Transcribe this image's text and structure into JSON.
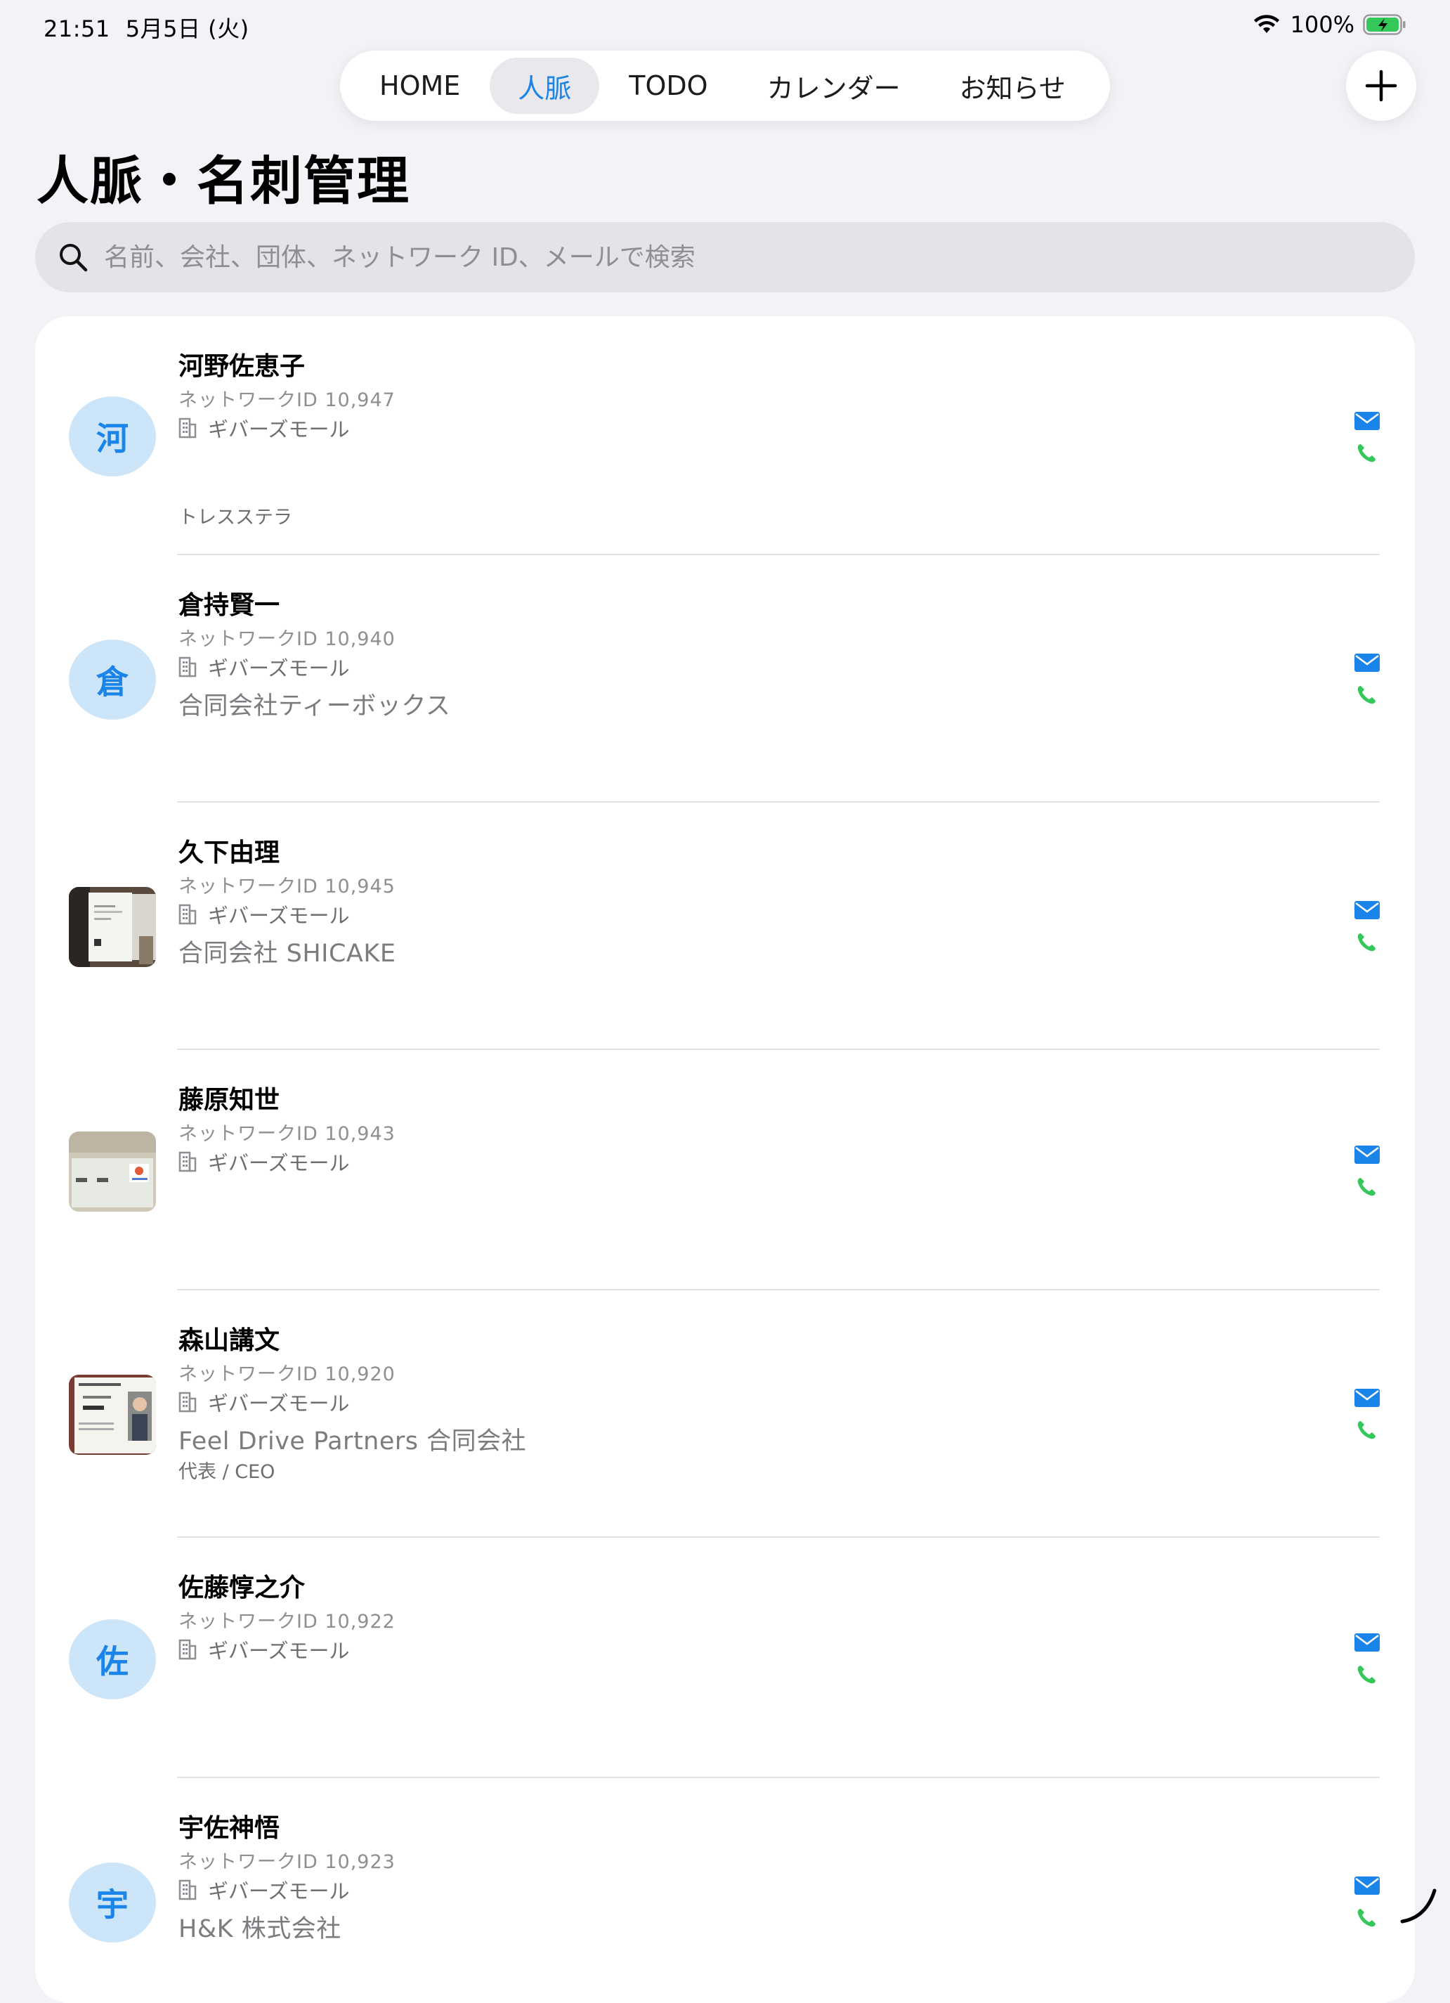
{
  "status": {
    "time": "21:51",
    "date": "5月5日 (火)",
    "battery": "100%"
  },
  "tabs": [
    {
      "label": "HOME",
      "active": false
    },
    {
      "label": "人脈",
      "active": true
    },
    {
      "label": "TODO",
      "active": false
    },
    {
      "label": "カレンダー",
      "active": false
    },
    {
      "label": "お知らせ",
      "active": false
    }
  ],
  "add_button_icon": "plus-icon",
  "page_title": "人脈・名刺管理",
  "search": {
    "placeholder": "名前、会社、団体、ネットワーク ID、メールで検索",
    "value": ""
  },
  "colors": {
    "accent": "#1a84e8",
    "avatar_bg": "#cde5f8",
    "phone": "#34c759",
    "mail": "#1a84e8"
  },
  "contacts": [
    {
      "name": "河野佐恵子",
      "network_id": "ネットワークID 10,947",
      "org": "ギバーズモール",
      "company": "",
      "note": "トレスステラ",
      "avatar_char": "河",
      "avatar_type": "initial"
    },
    {
      "name": "倉持賢一",
      "network_id": "ネットワークID 10,940",
      "org": "ギバーズモール",
      "company": "合同会社ティーボックス",
      "note": "",
      "avatar_char": "倉",
      "avatar_type": "initial"
    },
    {
      "name": "久下由理",
      "network_id": "ネットワークID 10,945",
      "org": "ギバーズモール",
      "company": "合同会社 SHICAKE",
      "note": "",
      "avatar_char": "",
      "avatar_type": "photo"
    },
    {
      "name": "藤原知世",
      "network_id": "ネットワークID 10,943",
      "org": "ギバーズモール",
      "company": "",
      "note": "",
      "avatar_char": "",
      "avatar_type": "photo"
    },
    {
      "name": "森山講文",
      "network_id": "ネットワークID 10,920",
      "org": "ギバーズモール",
      "company": "Feel Drive Partners 合同会社",
      "note": "代表 / CEO",
      "avatar_char": "",
      "avatar_type": "photo"
    },
    {
      "name": "佐藤惇之介",
      "network_id": "ネットワークID 10,922",
      "org": "ギバーズモール",
      "company": "",
      "note": "",
      "avatar_char": "佐",
      "avatar_type": "initial"
    },
    {
      "name": "宇佐神悟",
      "network_id": "ネットワークID 10,923",
      "org": "ギバーズモール",
      "company": "H&K 株式会社",
      "note": "",
      "avatar_char": "宇",
      "avatar_type": "initial"
    }
  ]
}
